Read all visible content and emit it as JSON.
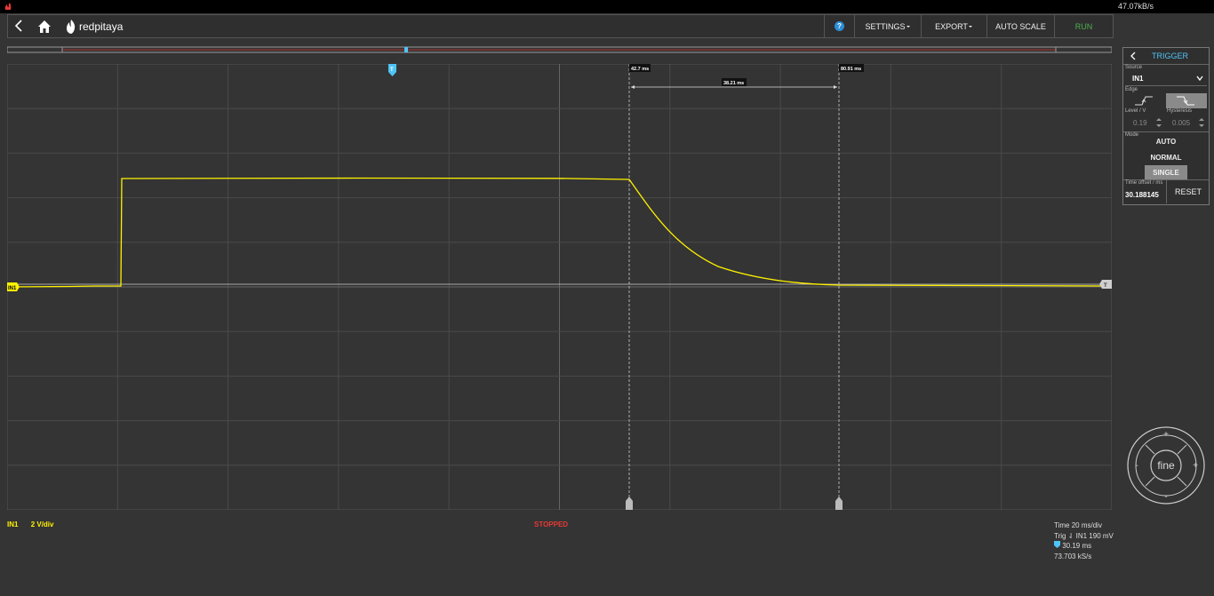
{
  "topbar": {
    "rate": "47.07kB/s"
  },
  "navbar": {
    "logo_text": "redpitaya",
    "help_label": "?",
    "settings_label": "SETTINGS",
    "export_label": "EXPORT",
    "autoscale_label": "AUTO SCALE",
    "run_label": "RUN"
  },
  "plot": {
    "channel_marker": "IN1",
    "trigger_marker": "T",
    "cursor1_label": "42.7 ms",
    "cursor2_label": "80.91 ms",
    "delta_label": "38.21 ms"
  },
  "trigger_panel": {
    "title": "TRIGGER",
    "source_label": "Source",
    "source_value": "IN1",
    "edge_label": "Edge",
    "level_label": "Level / V",
    "level_value": "0.19",
    "hysteresis_label": "Hysteresis",
    "hysteresis_value": "0.005",
    "mode_label": "Mode",
    "mode_auto": "AUTO",
    "mode_normal": "NORMAL",
    "mode_single": "SINGLE",
    "time_offset_label": "Time offset / ms",
    "time_offset_value": "30.188145",
    "reset_label": "RESET"
  },
  "status": {
    "channel": "IN1",
    "scale": "2 V/div",
    "state": "STOPPED",
    "time_div": "Time 20 ms/div",
    "trig": "Trig ⇃ IN1 190 mV",
    "t_offset": "30.19 ms",
    "sample_rate": "73.703 kS/s"
  },
  "wheel": {
    "center_label": "fine",
    "plus": "+",
    "minus": "-"
  },
  "colors": {
    "signal": "#fff200",
    "accent": "#4fc3f7",
    "run": "#4caf50",
    "stopped": "#e53935"
  },
  "icons": [
    "back-icon",
    "home-icon",
    "logo-flame-icon",
    "help-icon",
    "chevron-down-icon",
    "rising-edge-icon",
    "falling-edge-icon"
  ]
}
